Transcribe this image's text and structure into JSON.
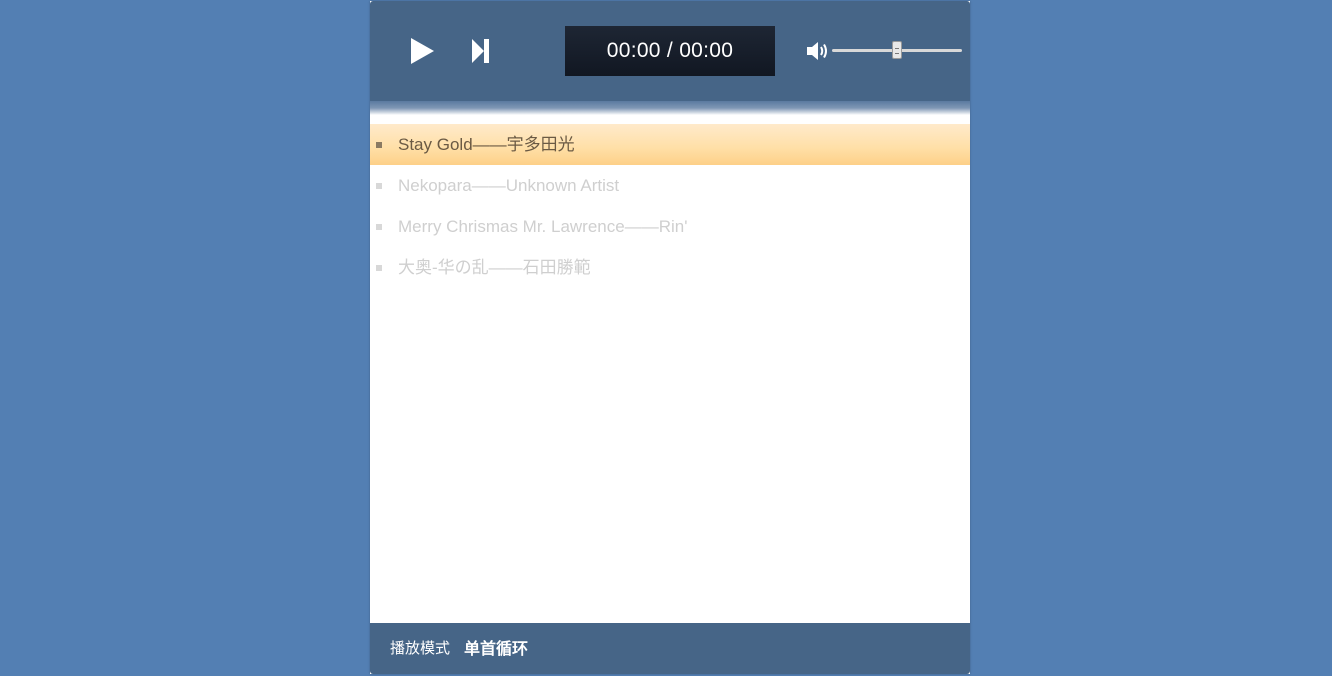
{
  "player": {
    "time_display": "00:00 / 00:00",
    "volume_level": 0.5
  },
  "icons": {
    "play": "play-icon",
    "next": "skip-next-icon",
    "volume": "volume-icon"
  },
  "playlist": [
    {
      "label": "Stay Gold——宇多田光",
      "active": true
    },
    {
      "label": "Nekopara——Unknown Artist",
      "active": false
    },
    {
      "label": "Merry Chrismas Mr. Lawrence——Rin'",
      "active": false
    },
    {
      "label": "大奥-华の乱——石田勝範",
      "active": false
    }
  ],
  "footer": {
    "mode_label": "播放模式",
    "mode_value": "单首循环"
  },
  "colors": {
    "page_background": "#537fb3",
    "bar_background": "#466587",
    "time_box": "#151c28",
    "active_track": "#ffdfa6"
  }
}
